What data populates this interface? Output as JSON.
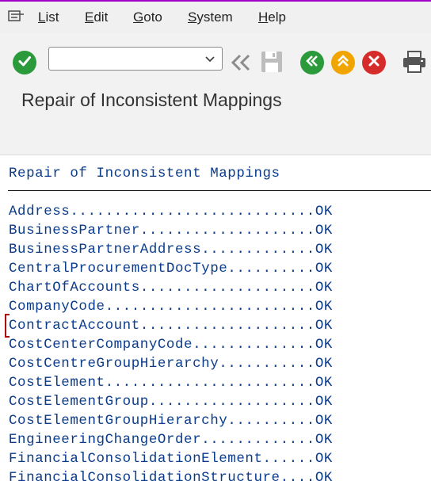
{
  "menu": {
    "items": [
      {
        "label": "List",
        "mnemonic": "L",
        "rest": "ist"
      },
      {
        "label": "Edit",
        "mnemonic": "E",
        "rest": "dit"
      },
      {
        "label": "Goto",
        "mnemonic": "G",
        "rest": "oto"
      },
      {
        "label": "System",
        "mnemonic": "S",
        "rest": "ystem"
      },
      {
        "label": "Help",
        "mnemonic": "H",
        "rest": "elp"
      }
    ]
  },
  "toolbar": {
    "command_field": {
      "value": "",
      "placeholder": ""
    },
    "icons": [
      "enter-check-icon",
      "command-dropdown-icon",
      "back-arrows-icon",
      "save-icon",
      "back-green-icon",
      "exit-yellow-icon",
      "cancel-red-icon",
      "print-icon"
    ],
    "colors": {
      "green": "#2a9a3b",
      "yellow": "#f0a500",
      "red": "#d62b2b",
      "gray": "#8c8c8c"
    }
  },
  "page": {
    "title": "Repair of Inconsistent Mappings"
  },
  "list": {
    "heading": "Repair of Inconsistent Mappings",
    "rows": [
      {
        "name": "Address",
        "status": "OK"
      },
      {
        "name": "BusinessPartner",
        "status": "OK"
      },
      {
        "name": "BusinessPartnerAddress",
        "status": "OK"
      },
      {
        "name": "CentralProcurementDocType",
        "status": "OK"
      },
      {
        "name": "ChartOfAccounts",
        "status": "OK"
      },
      {
        "name": "CompanyCode",
        "status": "OK"
      },
      {
        "name": "ContractAccount",
        "status": "OK"
      },
      {
        "name": "CostCenterCompanyCode",
        "status": "OK"
      },
      {
        "name": "CostCentreGroupHierarchy",
        "status": "OK"
      },
      {
        "name": "CostElement",
        "status": "OK"
      },
      {
        "name": "CostElementGroup",
        "status": "OK"
      },
      {
        "name": "CostElementGroupHierarchy",
        "status": "OK"
      },
      {
        "name": "EngineeringChangeOrder",
        "status": "OK"
      },
      {
        "name": "FinancialConsolidationElement",
        "status": "OK"
      },
      {
        "name": "FinancialConsolidationStructure",
        "status": "OK"
      }
    ],
    "text_color": "#0b3c8c"
  }
}
